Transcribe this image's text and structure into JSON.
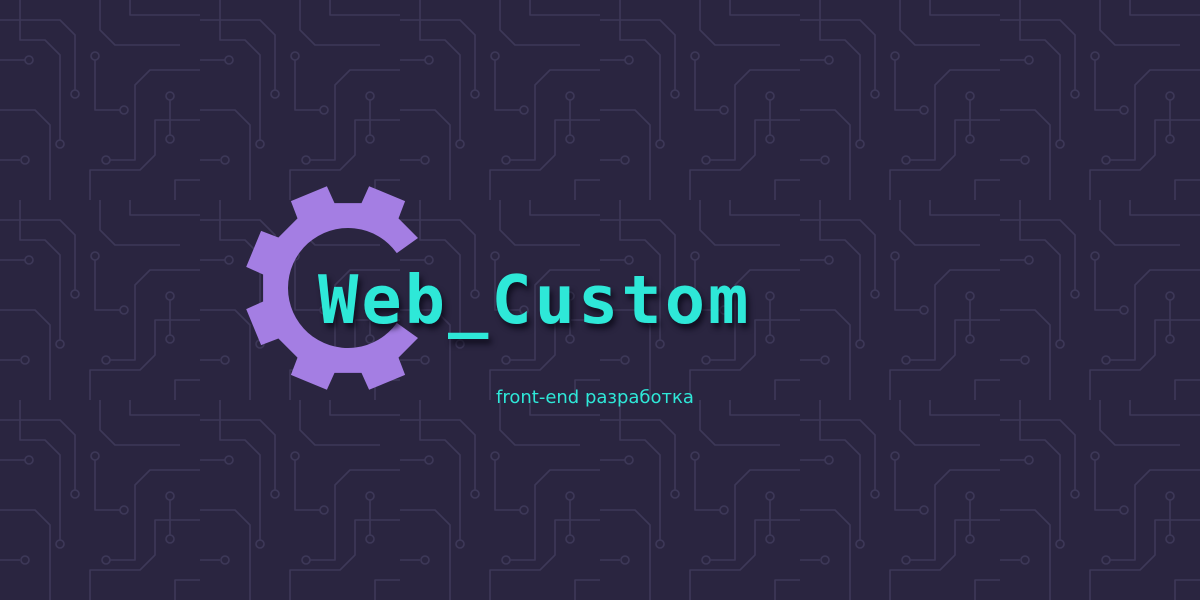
{
  "colors": {
    "background": "#2a2540",
    "circuit_trace": "#3d3858",
    "gear": "#a47ee3",
    "brand": "#2ee8d8",
    "tagline": "#2ee8d8"
  },
  "logo": {
    "icon": "gear-icon",
    "brand_name": "Web_Custom",
    "tagline": "front-end разработка"
  }
}
